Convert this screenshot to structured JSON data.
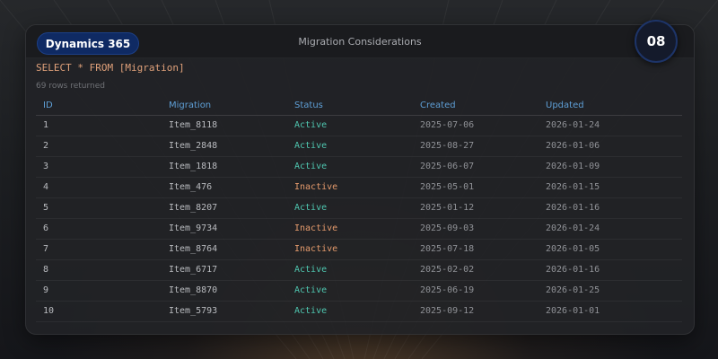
{
  "header": {
    "brand": "Dynamics 365",
    "title": "Migration Considerations",
    "page_number": "08"
  },
  "query": {
    "text": "SELECT * FROM [Migration]",
    "rows_returned": "69 rows returned"
  },
  "table": {
    "columns": [
      "ID",
      "Migration",
      "Status",
      "Created",
      "Updated"
    ],
    "rows": [
      [
        "1",
        "Item_8118",
        "Active",
        "2025-07-06",
        "2026-01-24"
      ],
      [
        "2",
        "Item_2848",
        "Active",
        "2025-08-27",
        "2026-01-06"
      ],
      [
        "3",
        "Item_1818",
        "Active",
        "2025-06-07",
        "2026-01-09"
      ],
      [
        "4",
        "Item_476",
        "Inactive",
        "2025-05-01",
        "2026-01-15"
      ],
      [
        "5",
        "Item_8207",
        "Active",
        "2025-01-12",
        "2026-01-16"
      ],
      [
        "6",
        "Item_9734",
        "Inactive",
        "2025-09-03",
        "2026-01-24"
      ],
      [
        "7",
        "Item_8764",
        "Inactive",
        "2025-07-18",
        "2026-01-05"
      ],
      [
        "8",
        "Item_6717",
        "Active",
        "2025-02-02",
        "2026-01-16"
      ],
      [
        "9",
        "Item_8870",
        "Active",
        "2025-06-19",
        "2026-01-25"
      ],
      [
        "10",
        "Item_5793",
        "Active",
        "2025-09-12",
        "2026-01-01"
      ]
    ]
  },
  "colors": {
    "brand_badge": "#0f2a63",
    "column_header": "#5e9fd6",
    "status_active": "#4fc7b0",
    "status_inactive": "#e49a6c",
    "query_text": "#e0a17a"
  }
}
